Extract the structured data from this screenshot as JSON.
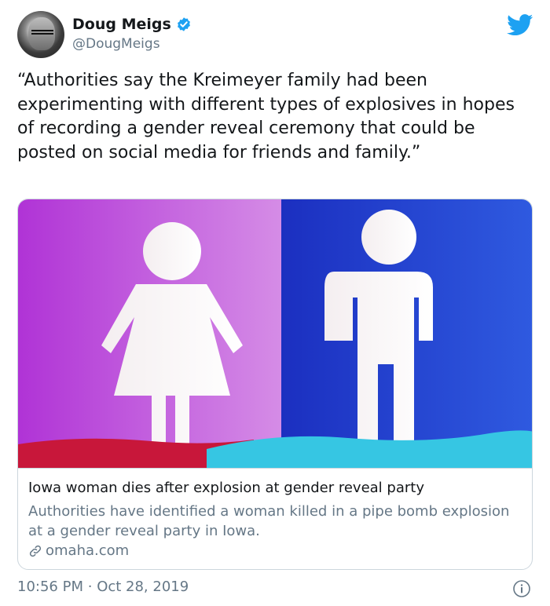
{
  "author": {
    "name": "Doug Meigs",
    "handle": "@DougMeigs"
  },
  "tweet": {
    "text": "“Authorities say the Kreimeyer family had been experimenting with different types of explosives in hopes of recording a gender reveal ceremony that could be posted on social media for friends and family.”"
  },
  "card": {
    "title": "Iowa woman dies after explosion at gender reveal party",
    "description": "Authorities have identified a woman killed in a pipe bomb explosion at a gender reveal party in Iowa.",
    "domain": "omaha.com",
    "image_icons": [
      "female-figure-icon",
      "male-figure-icon"
    ]
  },
  "meta": {
    "time": "10:56 PM",
    "separator": "·",
    "date": "Oct 28, 2019"
  },
  "icons": [
    "verified-badge-icon",
    "twitter-bird-icon",
    "link-icon",
    "info-icon"
  ],
  "colors": {
    "brand_blue": "#1da1f2",
    "secondary_text": "#657786",
    "border": "#ccd6dd",
    "image_left_bg": "#c03fd8",
    "image_right_bg": "#1f3fd0"
  }
}
